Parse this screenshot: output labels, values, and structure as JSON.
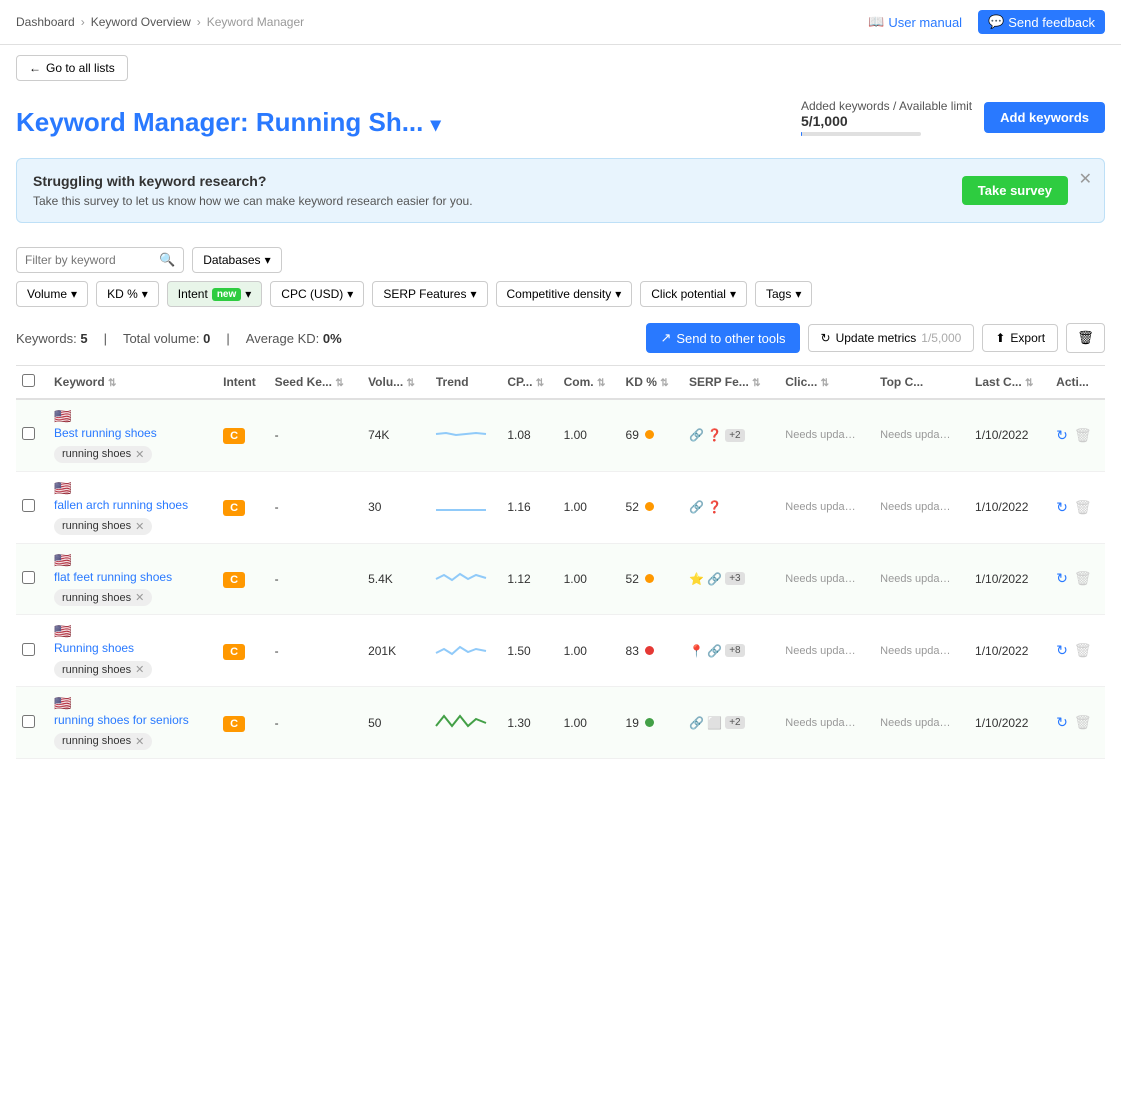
{
  "nav": {
    "breadcrumbs": [
      "Dashboard",
      "Keyword Overview",
      "Keyword Manager"
    ],
    "user_manual": "User manual",
    "send_feedback": "Send feedback"
  },
  "header": {
    "go_back": "Go to all lists",
    "title_static": "Keyword Manager:",
    "title_list": "Running Sh...",
    "limit_label": "Added keywords / Available limit",
    "limit_current": "5/1,000",
    "add_keywords": "Add keywords"
  },
  "banner": {
    "heading": "Struggling with keyword research?",
    "body": "Take this survey to let us know how we can make keyword research easier for you.",
    "cta": "Take survey"
  },
  "filters": {
    "search_placeholder": "Filter by keyword",
    "databases": "Databases",
    "volume": "Volume",
    "kd": "KD %",
    "intent": "Intent",
    "intent_new": "new",
    "cpc": "CPC (USD)",
    "serp": "SERP Features",
    "competitive": "Competitive density",
    "click": "Click potential",
    "tags": "Tags"
  },
  "stats": {
    "keywords_label": "Keywords:",
    "keywords_count": "5",
    "volume_label": "Total volume:",
    "volume_value": "0",
    "kd_label": "Average KD:",
    "kd_value": "0%",
    "send_tools": "Send to other tools",
    "update_metrics": "Update metrics",
    "update_limit": "1/5,000",
    "export": "Export"
  },
  "columns": [
    "Keyword",
    "Intent",
    "Seed Ke...",
    "Volu...",
    "Trend",
    "CP...",
    "Com.",
    "KD %",
    "SERP Fe...",
    "Clic...",
    "Top C...",
    "Last C...",
    "Acti..."
  ],
  "rows": [
    {
      "keyword": "Best running shoes",
      "tag": "running shoes",
      "intent": "C",
      "seed": "-",
      "volume": "74K",
      "trend": "flat",
      "cp": "1.08",
      "com": "1.00",
      "kd": "69",
      "kd_color": "orange",
      "serp_icons": [
        "🔗",
        "❓"
      ],
      "serp_extra": "+2",
      "clic": "Needs upda…",
      "topc": "Needs upda…",
      "lastc": "1/10/2022"
    },
    {
      "keyword": "fallen arch running shoes",
      "tag": "running shoes",
      "intent": "C",
      "seed": "-",
      "volume": "30",
      "trend": "flat_low",
      "cp": "1.16",
      "com": "1.00",
      "kd": "52",
      "kd_color": "orange",
      "serp_icons": [
        "🔗",
        "❓"
      ],
      "serp_extra": "",
      "clic": "Needs upda…",
      "topc": "Needs upda…",
      "lastc": "1/10/2022"
    },
    {
      "keyword": "flat feet running shoes",
      "tag": "running shoes",
      "intent": "C",
      "seed": "-",
      "volume": "5.4K",
      "trend": "wavy",
      "cp": "1.12",
      "com": "1.00",
      "kd": "52",
      "kd_color": "orange",
      "serp_icons": [
        "⭐",
        "🔗"
      ],
      "serp_extra": "+3",
      "clic": "Needs upda…",
      "topc": "Needs upda…",
      "lastc": "1/10/2022"
    },
    {
      "keyword": "Running shoes",
      "tag": "running shoes",
      "intent": "C",
      "seed": "-",
      "volume": "201K",
      "trend": "wavy2",
      "cp": "1.50",
      "com": "1.00",
      "kd": "83",
      "kd_color": "red",
      "serp_icons": [
        "📍",
        "🔗"
      ],
      "serp_extra": "+8",
      "clic": "Needs upda…",
      "topc": "Needs upda…",
      "lastc": "1/10/2022"
    },
    {
      "keyword": "running shoes for seniors",
      "tag": "running shoes",
      "intent": "C",
      "seed": "-",
      "volume": "50",
      "trend": "updown",
      "cp": "1.30",
      "com": "1.00",
      "kd": "19",
      "kd_color": "green",
      "serp_icons": [
        "🔗",
        "⬜"
      ],
      "serp_extra": "+2",
      "clic": "Needs upda…",
      "topc": "Needs upda…",
      "lastc": "1/10/2022"
    }
  ]
}
